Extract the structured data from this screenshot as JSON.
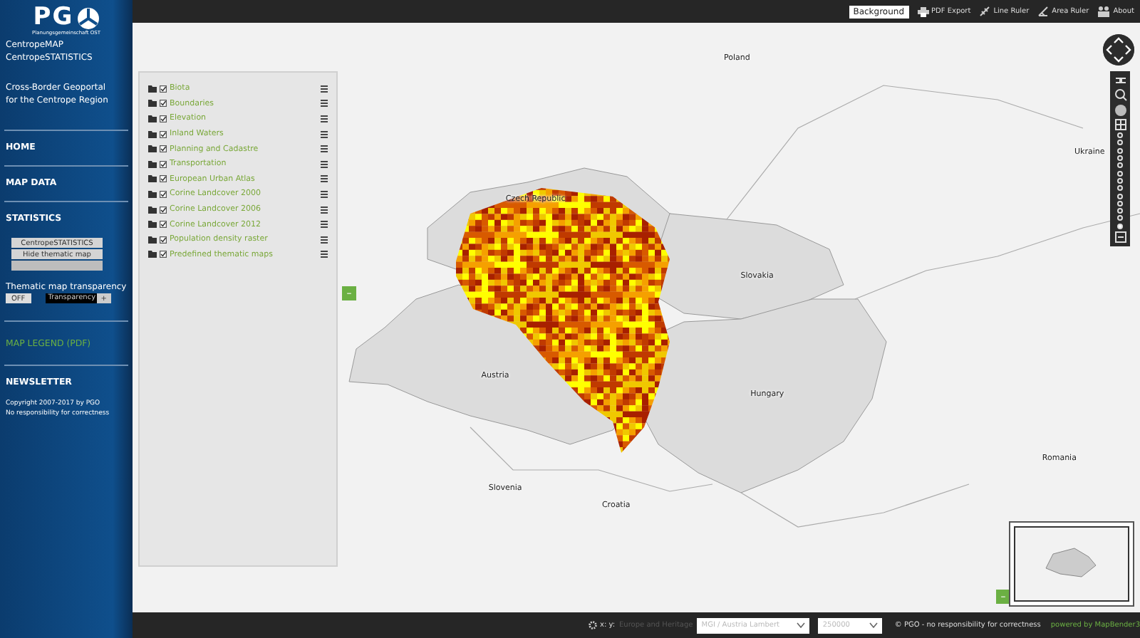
{
  "sidebar": {
    "logo": {
      "text": "PG",
      "subtitle": "Planungsgemeinschaft OST"
    },
    "app_names": [
      "CentropeMAP",
      "CentropeSTATISTICS"
    ],
    "tagline": "Cross-Border Geoportal for the Centrope Region",
    "nav": [
      {
        "label": "HOME",
        "kind": "heading"
      },
      {
        "label": "MAP DATA",
        "kind": "heading"
      },
      {
        "label": "STATISTICS",
        "kind": "heading"
      }
    ],
    "statistics_buttons": [
      {
        "label": "CentropeSTATISTICS",
        "disabled": false
      },
      {
        "label": "Hide thematic map",
        "disabled": false
      },
      {
        "disabled": true
      }
    ],
    "transparency": {
      "label": "Thematic map transparency",
      "off_button": "OFF",
      "field": "Transparency",
      "plus_button": "+"
    },
    "legend_link": "MAP LEGEND (PDF)",
    "newsletter": "NEWSLETTER",
    "copyright": [
      "Copyright 2007-2017 by PGO",
      "No responsibility for correctness"
    ]
  },
  "toolbar": {
    "background_button": "Background",
    "tools": [
      {
        "label": "PDF Export",
        "kind": "print"
      },
      {
        "label": "Line Ruler",
        "kind": "line"
      },
      {
        "label": "Area Ruler",
        "kind": "area"
      },
      {
        "label": "About",
        "kind": "about"
      }
    ]
  },
  "layers": [
    {
      "label": "Biota",
      "checked": true
    },
    {
      "label": "Boundaries",
      "checked": true
    },
    {
      "label": "Elevation",
      "checked": true
    },
    {
      "label": "Inland Waters",
      "checked": true
    },
    {
      "label": "Planning and Cadastre",
      "checked": true
    },
    {
      "label": "Transportation",
      "checked": true
    },
    {
      "label": "European Urban Atlas",
      "checked": true
    },
    {
      "label": "Corine Landcover 2000",
      "checked": true
    },
    {
      "label": "Corine Landcover 2006",
      "checked": true
    },
    {
      "label": "Corine Landcover 2012",
      "checked": true
    },
    {
      "label": "Population density raster",
      "checked": true
    },
    {
      "label": "Predefined thematic maps",
      "checked": true
    }
  ],
  "map": {
    "countries": [
      "Poland",
      "Ukraine",
      "Czech Republic",
      "Slovakia",
      "Austria",
      "Hungary",
      "Romania",
      "Slovenia",
      "Croatia"
    ],
    "collapse_buttons": [
      "–",
      "–"
    ],
    "zoom_levels": [
      {
        "selected": false
      },
      {
        "selected": false
      },
      {
        "selected": false
      },
      {
        "selected": false
      },
      {
        "selected": false
      },
      {
        "selected": false
      },
      {
        "selected": false
      },
      {
        "selected": false
      },
      {
        "selected": false
      },
      {
        "selected": false
      },
      {
        "selected": false
      },
      {
        "selected": false
      },
      {
        "selected": true
      }
    ]
  },
  "status_bar": {
    "coordinates": "x: y:",
    "layer_text": "Europe and Heritage",
    "projection": "MGI / Austria Lambert",
    "scale": "250000",
    "credits": "© PGO - no responsibility for correctness",
    "powered_by": "powered by MapBender3"
  }
}
